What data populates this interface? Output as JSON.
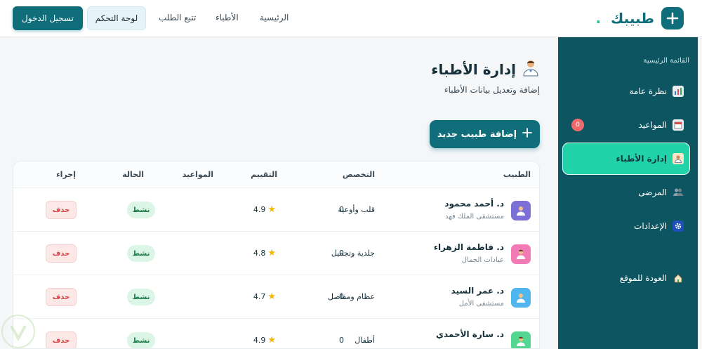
{
  "brand": {
    "name": "طبيبك",
    "dot": "."
  },
  "nav": {
    "home": "الرئيسية",
    "doctors": "الأطباء",
    "track": "تتبع الطلب",
    "dashboard": "لوحة التحكم",
    "login": "تسجيل الدخول"
  },
  "sidebar": {
    "heading": "القائمة الرئيسية",
    "items": [
      {
        "label": "نظرة عامة",
        "icon": "bar-chart-icon"
      },
      {
        "label": "المواعيد",
        "icon": "calendar-icon",
        "badge": "0"
      },
      {
        "label": "إدارة الأطباء",
        "icon": "doctor-icon",
        "active": true
      },
      {
        "label": "المرضى",
        "icon": "users-icon"
      },
      {
        "label": "الإعدادات",
        "icon": "gear-icon"
      },
      {
        "label": "العودة للموقع",
        "icon": "home-icon"
      }
    ]
  },
  "page": {
    "title": "إدارة الأطباء",
    "subtitle": "إضافة وتعديل بيانات الأطباء",
    "add_button": "إضافة طبيب جديد"
  },
  "table": {
    "headers": {
      "doctor": "الطبيب",
      "specialty": "التخصص",
      "rating": "التقييم",
      "appointments": "المواعيد",
      "status": "الحالة",
      "action": "إجراء"
    },
    "rows": [
      {
        "name": "د. أحمد محمود",
        "hospital": "مستشفى الملك فهد",
        "specialty": "قلب وأوعية",
        "rating": "4.9",
        "appointments": "0",
        "status": "نشط",
        "action": "حذف",
        "avatar_color": "#7c6fd6"
      },
      {
        "name": "د. فاطمة الزهراء",
        "hospital": "عيادات الجمال",
        "specialty": "جلدية وتجميل",
        "rating": "4.8",
        "appointments": "0",
        "status": "نشط",
        "action": "حذف",
        "avatar_color": "#f27bb5"
      },
      {
        "name": "د. عمر السيد",
        "hospital": "مستشفى الأمل",
        "specialty": "عظام ومفاصل",
        "rating": "4.7",
        "appointments": "0",
        "status": "نشط",
        "action": "حذف",
        "avatar_color": "#4fb6f0"
      },
      {
        "name": "د. سارة الأحمدي",
        "hospital": "",
        "specialty": "أطفال",
        "rating": "4.9",
        "appointments": "0",
        "status": "نشط",
        "action": "حذف",
        "avatar_color": "#53d68f"
      }
    ]
  },
  "colors": {
    "primary": "#0f6e7a",
    "accent": "#22d3a9",
    "sidebar": "#0d5560",
    "badge": "#ef6b6b"
  }
}
